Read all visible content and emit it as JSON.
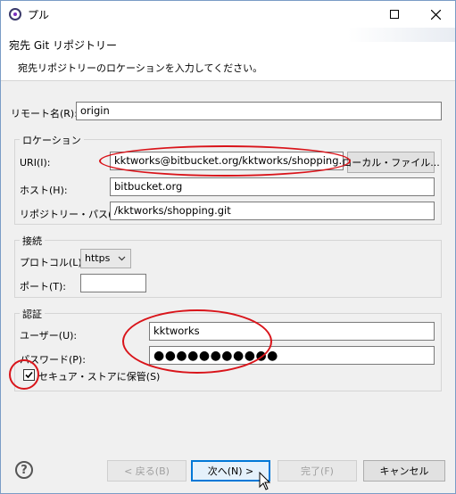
{
  "window": {
    "title": "プル"
  },
  "header": {
    "title": "宛先 Git リポジトリー",
    "description": "宛先リポジトリーのロケーションを入力してください。"
  },
  "remote": {
    "label": "リモート名(R):",
    "value": "origin"
  },
  "location": {
    "group_title": "ロケーション",
    "uri_label": "URI(I):",
    "uri_value": "kktworks@bitbucket.org/kktworks/shopping.git",
    "local_file_button": "ローカル・ファイル...",
    "host_label": "ホスト(H):",
    "host_value": "bitbucket.org",
    "path_label": "リポジトリー・パス(R):",
    "path_value": "/kktworks/shopping.git"
  },
  "connection": {
    "group_title": "接続",
    "protocol_label": "プロトコル(L):",
    "protocol_value": "https",
    "port_label": "ポート(T):",
    "port_value": ""
  },
  "auth": {
    "group_title": "認証",
    "user_label": "ユーザー(U):",
    "user_value": "kktworks",
    "password_label": "パスワード(P):",
    "password_value": "●●●●●●●●●●●",
    "secure_store_label": "セキュア・ストアに保管(S)",
    "secure_store_checked": true
  },
  "buttons": {
    "back": "< 戻る(B)",
    "next": "次へ(N) >",
    "finish": "完了(F)",
    "cancel": "キャンセル"
  },
  "help_icon": "?",
  "colors": {
    "annotation": "#d9141a",
    "focus": "#0078d7"
  }
}
